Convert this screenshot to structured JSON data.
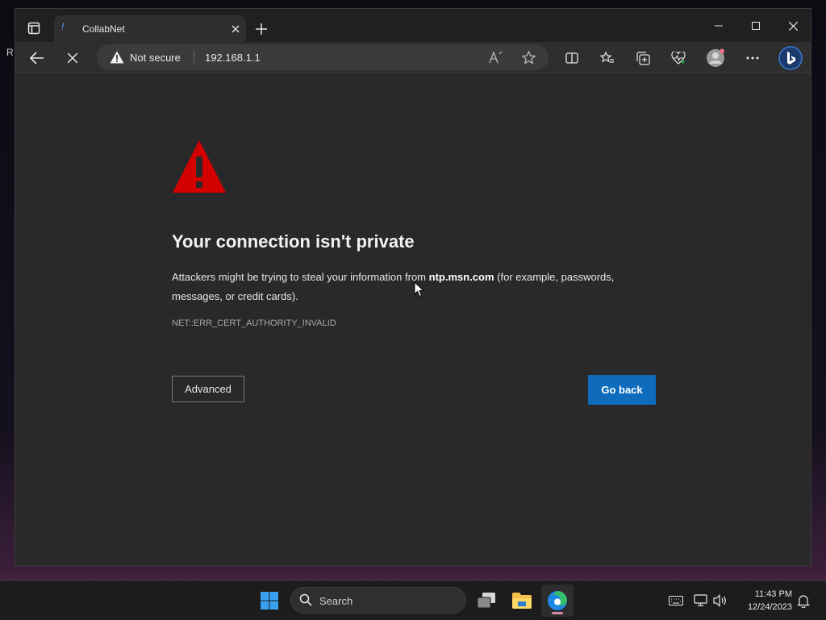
{
  "desktop": {
    "label": "R"
  },
  "browser": {
    "tab": {
      "title": "CollabNet",
      "favicon": "!"
    },
    "address": {
      "security_label": "Not secure",
      "url": "192.168.1.1"
    }
  },
  "error_page": {
    "title": "Your connection isn't private",
    "description_prefix": "Attackers might be trying to steal your information from ",
    "domain": "ntp.msn.com",
    "description_suffix": " (for example, passwords, messages, or credit cards).",
    "error_code": "NET::ERR_CERT_AUTHORITY_INVALID",
    "advanced_label": "Advanced",
    "go_back_label": "Go back",
    "warning_color": "#d30000",
    "accent_color": "#0f6cbd"
  },
  "taskbar": {
    "search_placeholder": "Search",
    "time": "11:43 PM",
    "date": "12/24/2023"
  }
}
